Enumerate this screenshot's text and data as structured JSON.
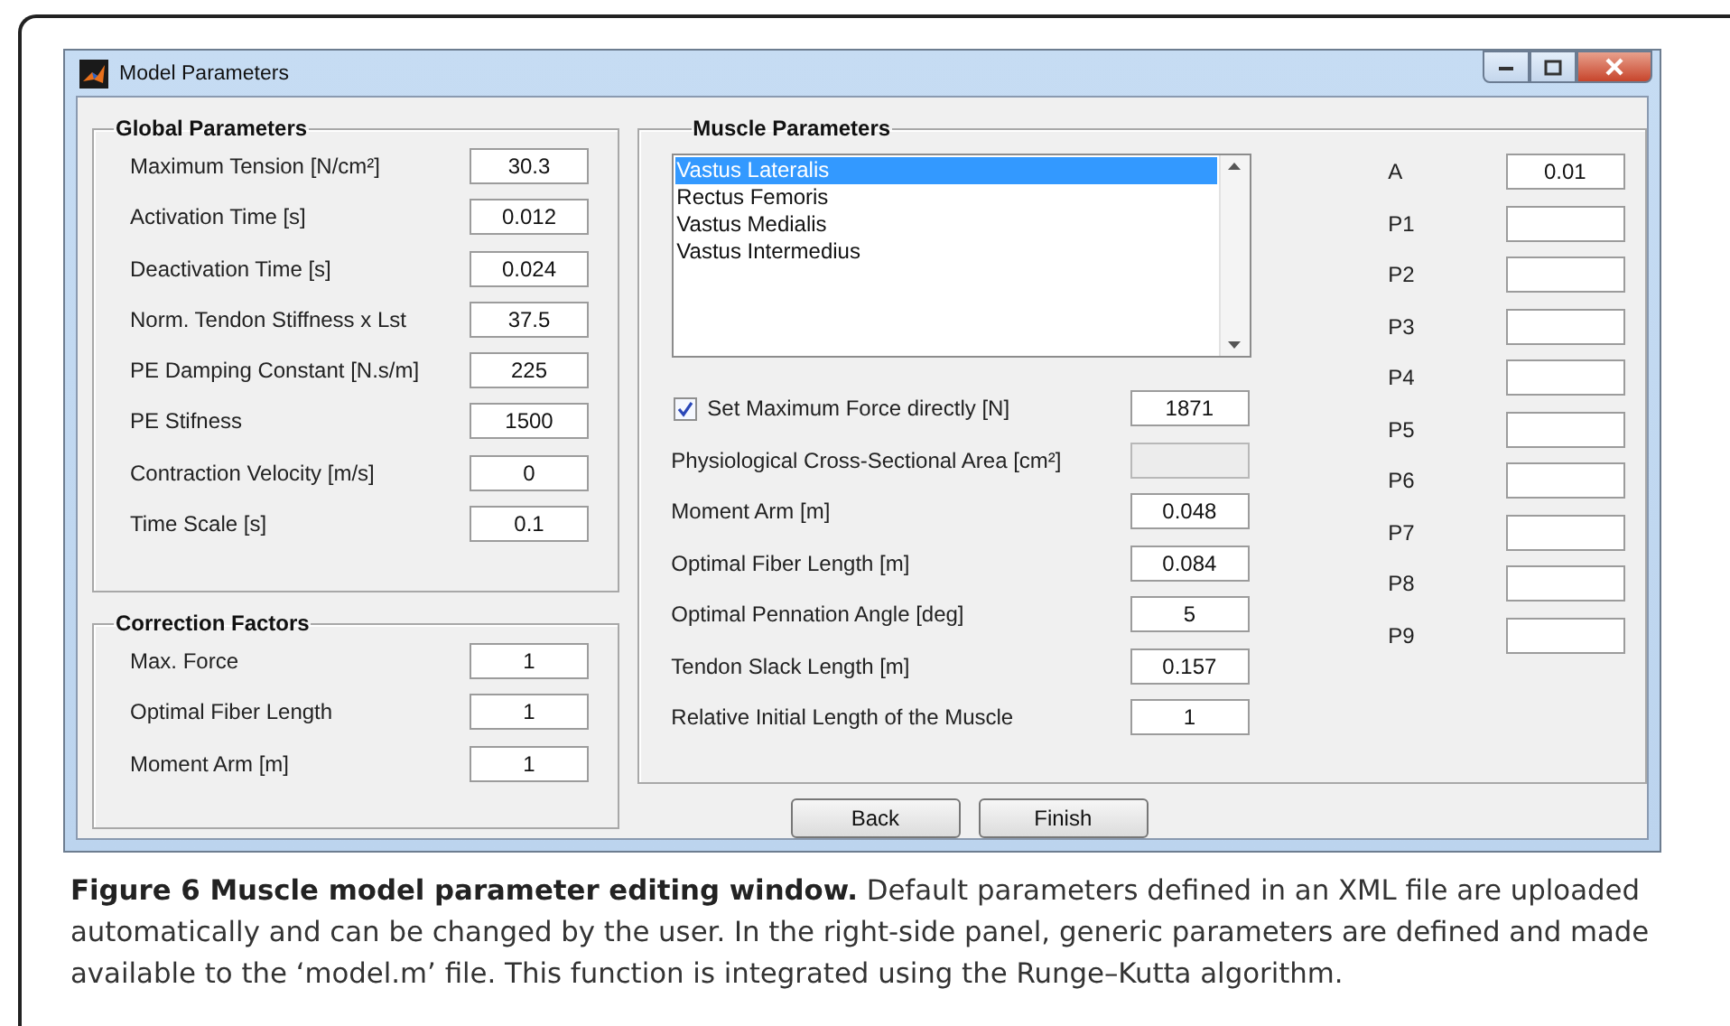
{
  "window": {
    "title": "Model Parameters"
  },
  "global_parameters": {
    "title": "Global Parameters",
    "rows": [
      {
        "label": "Maximum Tension [N/cm²]",
        "value": "30.3"
      },
      {
        "label": "Activation Time [s]",
        "value": "0.012"
      },
      {
        "label": "Deactivation Time [s]",
        "value": "0.024"
      },
      {
        "label": "Norm. Tendon Stiffness x Lst",
        "value": "37.5"
      },
      {
        "label": "PE Damping Constant [N.s/m]",
        "value": "225"
      },
      {
        "label": "PE Stifness",
        "value": "1500"
      },
      {
        "label": "Contraction Velocity [m/s]",
        "value": "0"
      },
      {
        "label": "Time Scale [s]",
        "value": "0.1"
      }
    ]
  },
  "correction_factors": {
    "title": "Correction Factors",
    "rows": [
      {
        "label": "Max. Force",
        "value": "1"
      },
      {
        "label": "Optimal Fiber Length",
        "value": "1"
      },
      {
        "label": "Moment Arm [m]",
        "value": "1"
      }
    ]
  },
  "muscle_parameters": {
    "title": "Muscle Parameters",
    "muscles": [
      {
        "name": "Vastus Lateralis",
        "selected": true
      },
      {
        "name": "Rectus Femoris",
        "selected": false
      },
      {
        "name": "Vastus Medialis",
        "selected": false
      },
      {
        "name": "Vastus Intermedius",
        "selected": false
      }
    ],
    "fields": [
      {
        "kind": "checkbox",
        "label": "Set Maximum Force directly [N]",
        "checked": true,
        "value": "1871",
        "disabled": false
      },
      {
        "kind": "text",
        "label": "Physiological Cross-Sectional Area [cm²]",
        "disabled": true
      },
      {
        "kind": "text",
        "label": "Moment Arm [m]",
        "value": "0.048",
        "disabled": false
      },
      {
        "kind": "text",
        "label": "Optimal Fiber Length [m]",
        "value": "0.084",
        "disabled": false
      },
      {
        "kind": "text",
        "label": "Optimal Pennation Angle [deg]",
        "value": "5",
        "disabled": false
      },
      {
        "kind": "text",
        "label": "Tendon Slack Length [m]",
        "value": "0.157",
        "disabled": false
      },
      {
        "kind": "text",
        "label": "Relative Initial Length of the Muscle",
        "value": "1",
        "disabled": false
      }
    ],
    "generic": [
      {
        "label": "A",
        "value": "0.01"
      },
      {
        "label": "P1"
      },
      {
        "label": "P2"
      },
      {
        "label": "P3"
      },
      {
        "label": "P4"
      },
      {
        "label": "P5"
      },
      {
        "label": "P6"
      },
      {
        "label": "P7"
      },
      {
        "label": "P8"
      },
      {
        "label": "P9"
      }
    ]
  },
  "buttons": [
    "Back",
    "Finish"
  ],
  "caption": "**Figure 6 Muscle model parameter editing window.** Default parameters defined in an XML file are uploaded automatically and can be changed by the user. In the right-side panel, generic parameters are defined and made available to the ‘model.m’ file. This function is integrated using the Runge–Kutta algorithm."
}
